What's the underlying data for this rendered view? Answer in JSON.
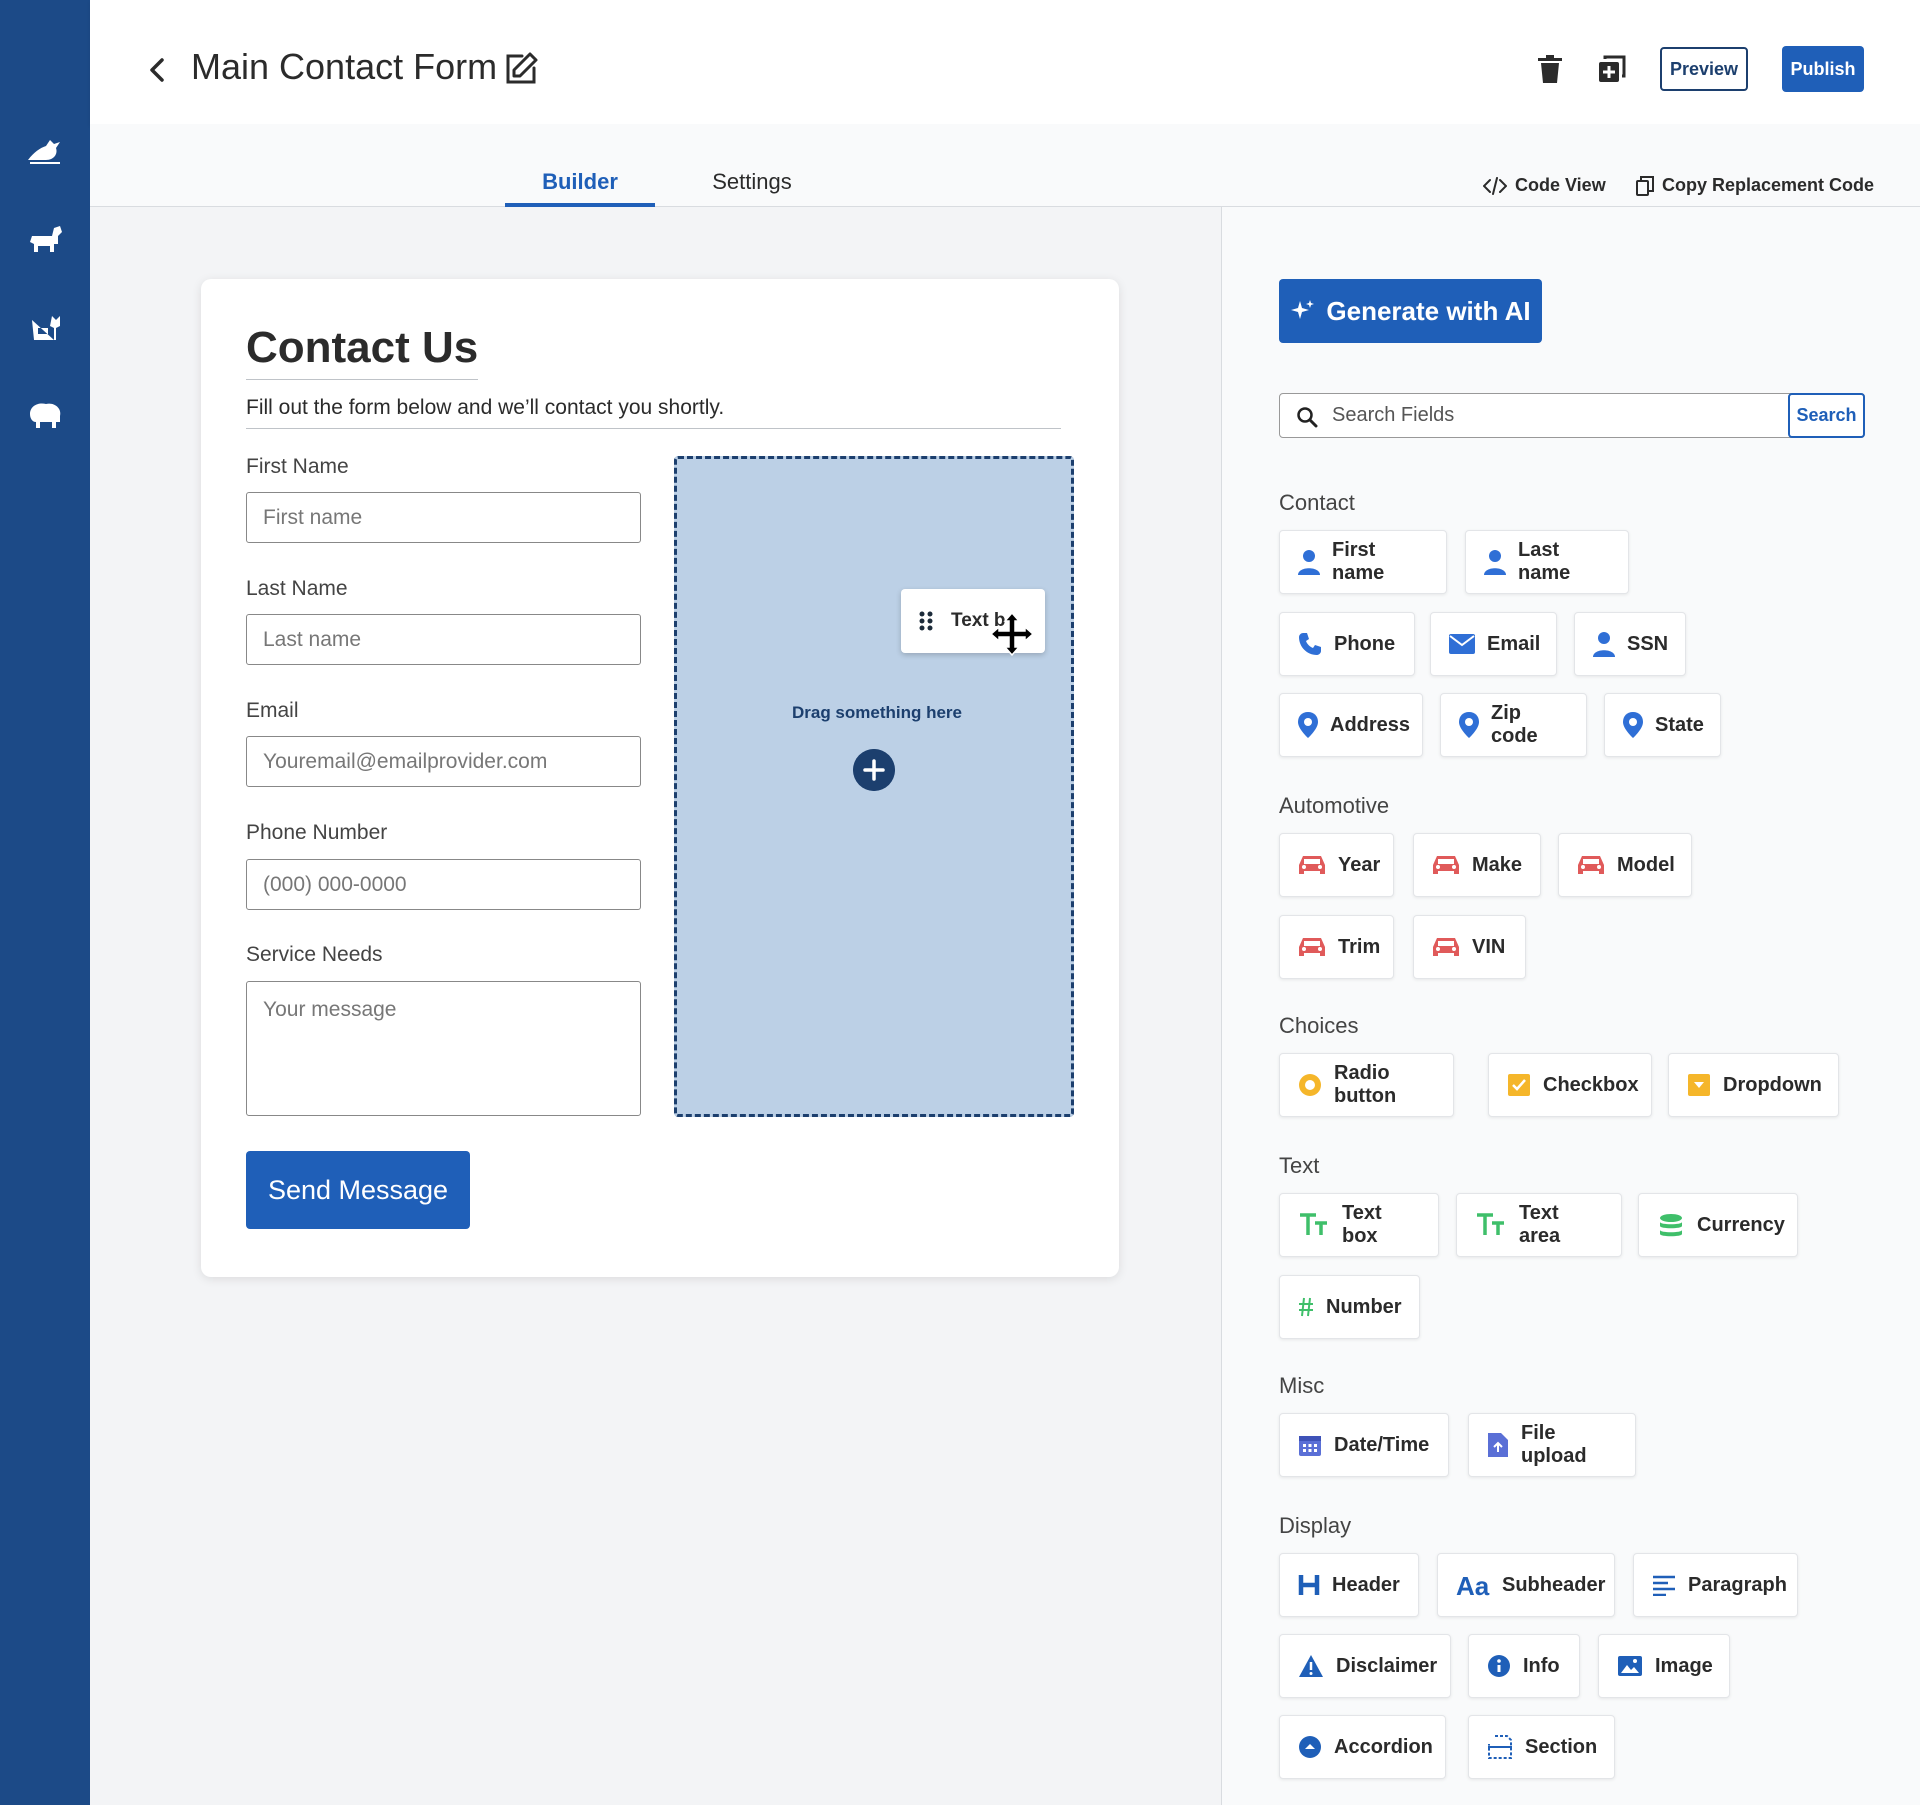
{
  "header": {
    "title": "Main Contact Form",
    "preview_label": "Preview",
    "publish_label": "Publish"
  },
  "tabs": {
    "builder": "Builder",
    "settings": "Settings",
    "code_view": "Code View",
    "copy_code": "Copy Replacement Code"
  },
  "form": {
    "title": "Contact Us",
    "subtitle": "Fill out the form below and we’ll contact you shortly.",
    "first_name_label": "First Name",
    "first_name_placeholder": "First name",
    "last_name_label": "Last Name",
    "last_name_placeholder": "Last name",
    "email_label": "Email",
    "email_placeholder": "Youremail@emailprovider.com",
    "phone_label": "Phone Number",
    "phone_placeholder": "(000) 000-0000",
    "service_label": "Service Needs",
    "service_placeholder": "Your message",
    "submit_label": "Send Message",
    "drop_text": "Drag something here",
    "drag_chip_label": "Text b"
  },
  "panel": {
    "ai_label": "Generate with AI",
    "search_placeholder": "Search Fields",
    "search_label": "Search",
    "sections": {
      "contact": "Contact",
      "automotive": "Automotive",
      "choices": "Choices",
      "text": "Text",
      "misc": "Misc",
      "display": "Display"
    },
    "contact": [
      "First name",
      "Last name",
      "Phone",
      "Email",
      "SSN",
      "Address",
      "Zip code",
      "State"
    ],
    "automotive": [
      "Year",
      "Make",
      "Model",
      "Trim",
      "VIN"
    ],
    "choices": [
      "Radio button",
      "Checkbox",
      "Dropdown"
    ],
    "text": [
      "Text box",
      "Text area",
      "Currency",
      "Number"
    ],
    "misc": [
      "Date/Time",
      "File upload"
    ],
    "display": [
      "Header",
      "Subheader",
      "Paragraph",
      "Disclaimer",
      "Info",
      "Image",
      "Accordion",
      "Section"
    ]
  },
  "colors": {
    "rail": "#1c4a87",
    "accent": "#1f5fb8",
    "automotive_icon": "#e05a5a",
    "choice_icon": "#f5b62a",
    "text_icon": "#3fbf6a"
  }
}
